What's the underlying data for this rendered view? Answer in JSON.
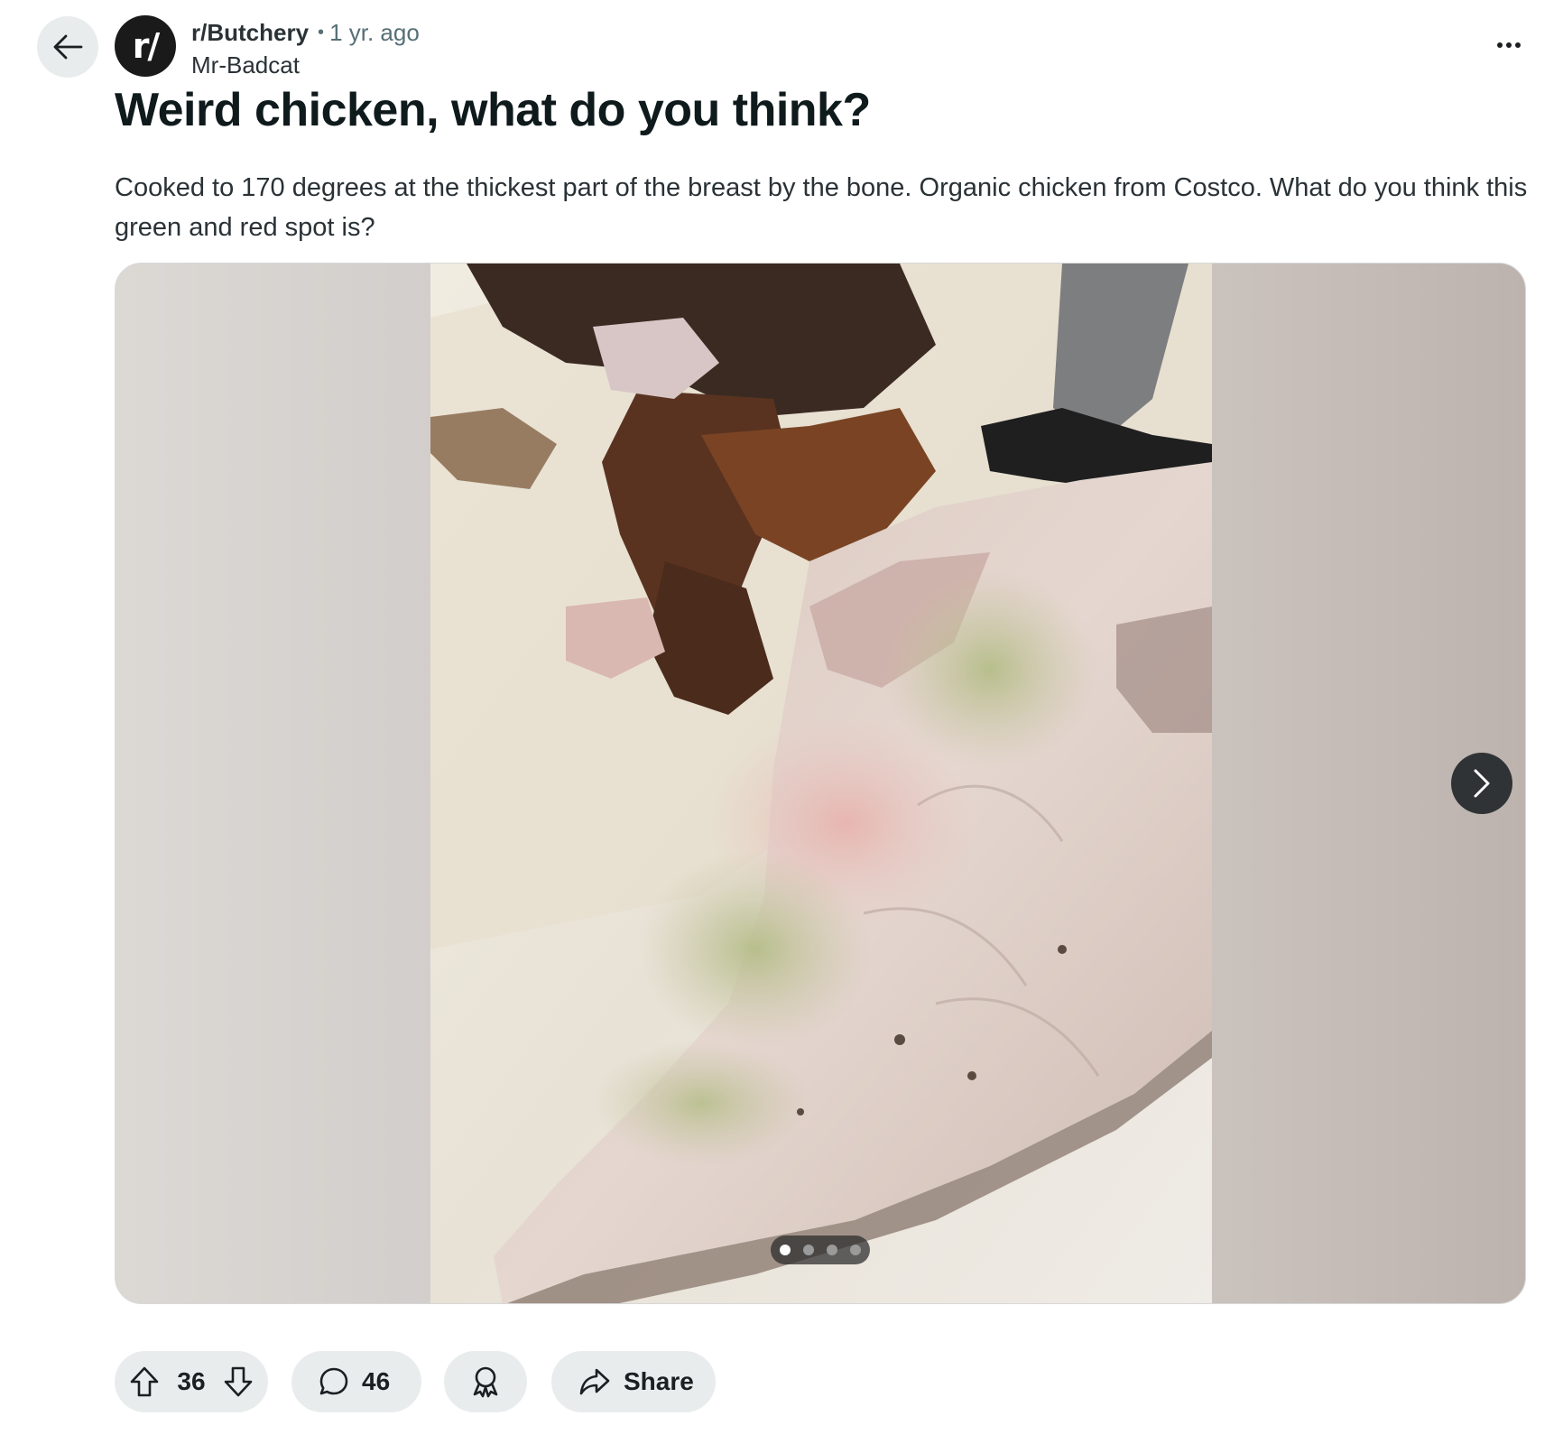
{
  "header": {
    "subreddit_icon_text": "r/",
    "subreddit": "r/Butchery",
    "separator": "•",
    "age": "1 yr. ago",
    "author": "Mr-Badcat"
  },
  "post": {
    "title": "Weird chicken, what do you think?",
    "body": "Cooked to 170 degrees at the thickest part of the breast by the bone. Organic chicken from Costco. What do you think this green and red spot is?"
  },
  "gallery": {
    "image_count": 4,
    "current_index": 1
  },
  "actions": {
    "vote_count": "36",
    "comment_count": "46",
    "share_label": "Share"
  },
  "colors": {
    "pill_background": "#e9eced",
    "next_button": "#2f3335",
    "text_primary": "#0f1a1c",
    "text_meta": "#576f76"
  },
  "icons": [
    "back-arrow-icon",
    "overflow-menu-icon",
    "chevron-right-icon",
    "upvote-icon",
    "downvote-icon",
    "comment-icon",
    "award-icon",
    "share-icon"
  ]
}
